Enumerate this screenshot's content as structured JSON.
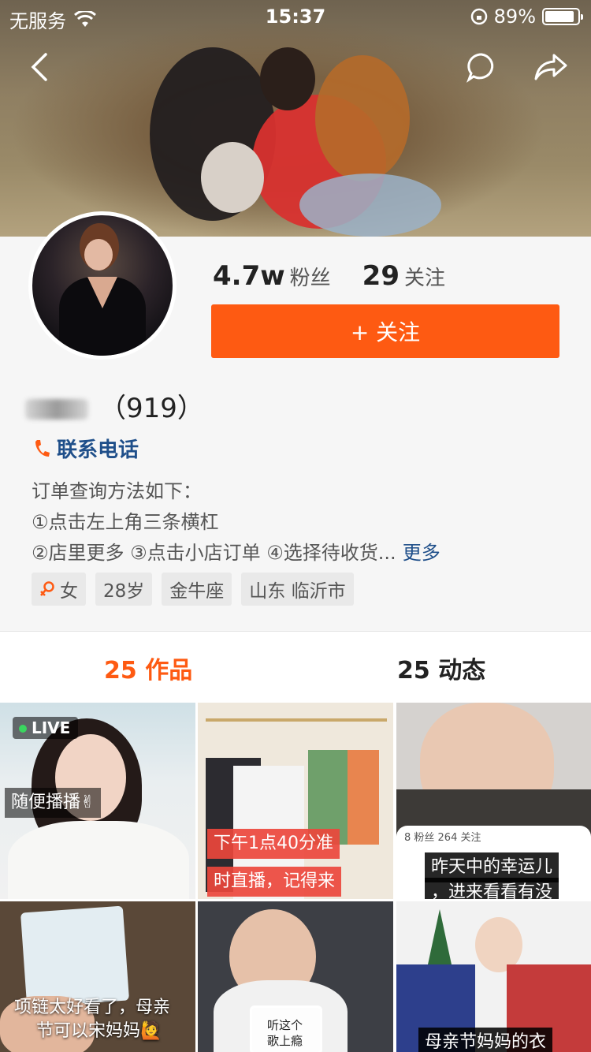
{
  "status_bar": {
    "carrier": "无服务",
    "time": "15:37",
    "battery": "89%",
    "battery_level": 0.89
  },
  "profile": {
    "fans_count": "4.7w",
    "fans_label": "粉丝",
    "following_count": "29",
    "following_label": "关注",
    "follow_button": "+ 关注",
    "name_suffix": "（919）",
    "contact_label": "联系电话",
    "bio_lines": [
      "订单查询方法如下：",
      "①点击左上角三条横杠",
      "②店里更多 ③点击小店订单 ④选择待收货..."
    ],
    "more_link": "更多",
    "tags": [
      "女",
      "28岁",
      "金牛座",
      "山东 临沂市"
    ]
  },
  "tabs": [
    {
      "count": "25",
      "label": "作品"
    },
    {
      "count": "25",
      "label": "动态"
    }
  ],
  "grid": {
    "live_badge": "LIVE",
    "captions": [
      "随便播播✌",
      "下午1点40分准",
      "时直播，记得来",
      "昨天中的幸运儿",
      "，进来看看有没",
      "项链太好看了，母亲",
      "节可以宋妈妈🙋",
      "听这个",
      "歌上瘾",
      "母亲节妈妈的衣"
    ],
    "cell3_mini_stats": "8 粉丝    264 关注"
  },
  "colors": {
    "accent": "#fe5a12",
    "link": "#1f4f8a"
  }
}
